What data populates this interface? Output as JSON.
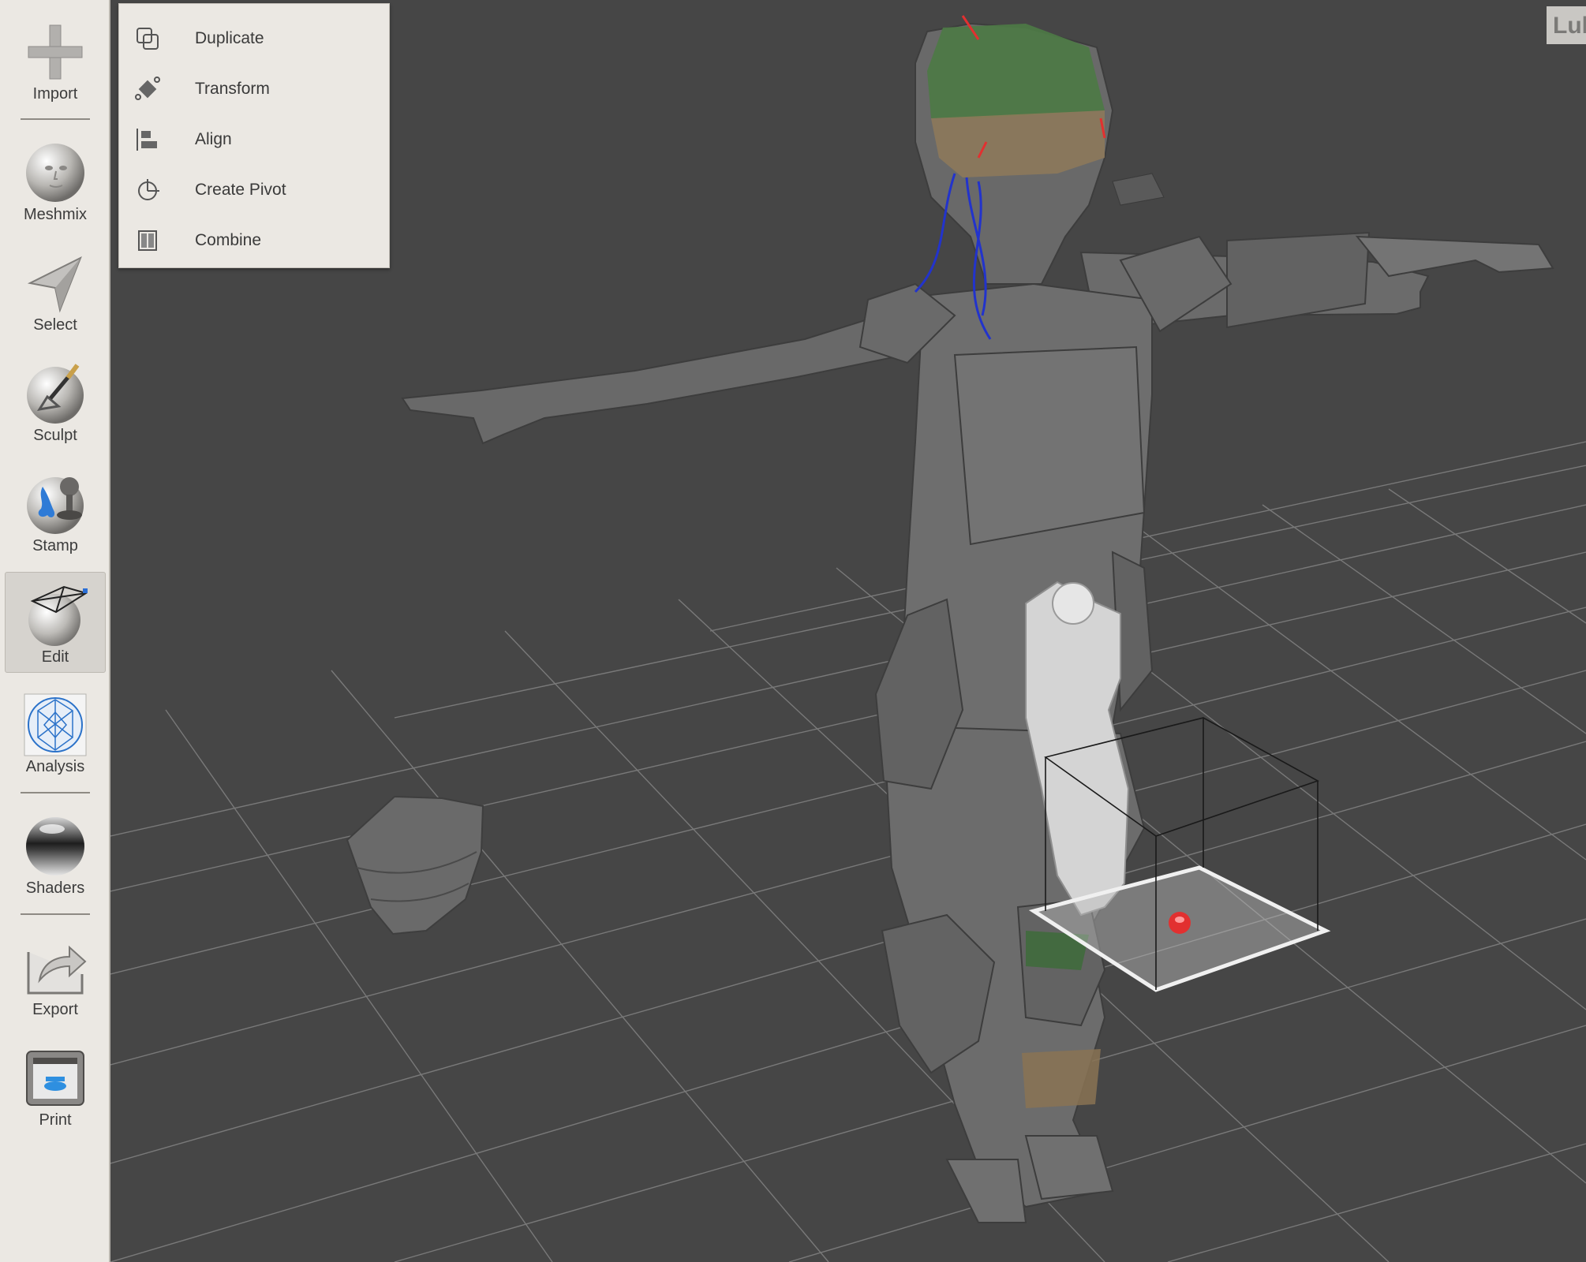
{
  "sidebar": {
    "tools": [
      {
        "label": "Import",
        "icon": "plus-icon"
      },
      {
        "label": "Meshmix",
        "icon": "face-sphere-icon"
      },
      {
        "label": "Select",
        "icon": "arrow-cursor-icon"
      },
      {
        "label": "Sculpt",
        "icon": "brush-sphere-icon"
      },
      {
        "label": "Stamp",
        "icon": "stamp-sphere-icon"
      },
      {
        "label": "Edit",
        "icon": "wireframe-sphere-icon",
        "active": true
      },
      {
        "label": "Analysis",
        "icon": "mesh-analysis-icon"
      },
      {
        "label": "Shaders",
        "icon": "chrome-sphere-icon"
      },
      {
        "label": "Export",
        "icon": "export-arrow-icon"
      },
      {
        "label": "Print",
        "icon": "printer-icon"
      }
    ]
  },
  "edit_menu": {
    "items": [
      {
        "label": "Duplicate",
        "icon": "duplicate-icon"
      },
      {
        "label": "Transform",
        "icon": "transform-icon"
      },
      {
        "label": "Align",
        "icon": "align-icon"
      },
      {
        "label": "Create Pivot",
        "icon": "pivot-icon"
      },
      {
        "label": "Combine",
        "icon": "combine-icon"
      }
    ]
  },
  "corner_tab": {
    "text": "Lul"
  },
  "colors": {
    "viewport_bg": "#464646",
    "grid_line": "#8a8a8a",
    "model_gray": "#6c6c6c",
    "helmet_green": "#4d7a45",
    "helmet_tan": "#8f7a5a",
    "cable_blue": "#2233cc",
    "pivot_red": "#e23030",
    "panel_bg": "#ebe8e3"
  }
}
